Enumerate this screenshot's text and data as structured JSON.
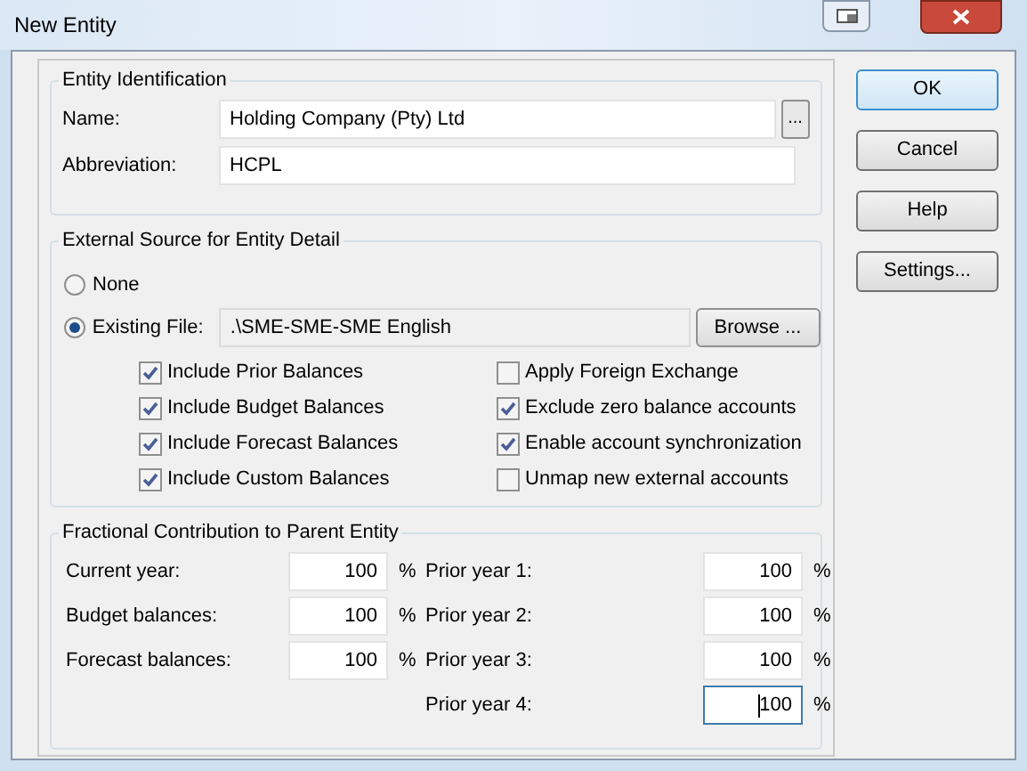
{
  "window": {
    "title": "New Entity"
  },
  "identification": {
    "title": "Entity Identification",
    "fields": [
      {
        "label": "Name:",
        "value": "Holding Company (Pty) Ltd",
        "picker": "..."
      },
      {
        "label": "Abbreviation:",
        "value": "HCPL"
      }
    ]
  },
  "external_source": {
    "title": "External Source for Entity Detail",
    "options": [
      {
        "label": "None",
        "selected": false
      },
      {
        "label": "Existing File:",
        "selected": true,
        "value": ".\\SME-SME-SME English",
        "button": "Browse ..."
      }
    ],
    "left_checkboxes": [
      {
        "label": "Include Prior Balances",
        "checked": true
      },
      {
        "label": "Include Budget Balances",
        "checked": true
      },
      {
        "label": "Include Forecast Balances",
        "checked": true
      },
      {
        "label": "Include Custom Balances",
        "checked": true
      }
    ],
    "right_checkboxes": [
      {
        "label": "Apply Foreign Exchange",
        "checked": false
      },
      {
        "label": "Exclude zero balance accounts",
        "checked": true
      },
      {
        "label": "Enable account synchronization",
        "checked": true
      },
      {
        "label": "Unmap new external accounts",
        "checked": false
      }
    ]
  },
  "fractional": {
    "title": "Fractional Contribution to Parent Entity",
    "left": [
      {
        "label": "Current year:",
        "value": "100",
        "unit": "%"
      },
      {
        "label": "Budget balances:",
        "value": "100",
        "unit": "%"
      },
      {
        "label": "Forecast balances:",
        "value": "100",
        "unit": "%"
      }
    ],
    "right": [
      {
        "label": "Prior year 1:",
        "value": "100",
        "unit": "%",
        "focused": false
      },
      {
        "label": "Prior year 2:",
        "value": "100",
        "unit": "%",
        "focused": false
      },
      {
        "label": "Prior year 3:",
        "value": "100",
        "unit": "%",
        "focused": false
      },
      {
        "label": "Prior year 4:",
        "value": "100",
        "unit": "%",
        "focused": true
      }
    ]
  },
  "buttons": [
    {
      "label": "OK",
      "default": true
    },
    {
      "label": "Cancel",
      "default": false
    },
    {
      "label": "Help",
      "default": false
    },
    {
      "label": "Settings...",
      "default": false
    }
  ]
}
